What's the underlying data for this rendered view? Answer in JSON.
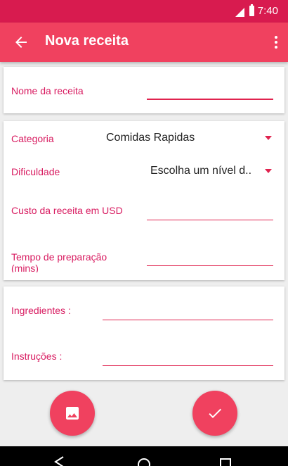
{
  "status": {
    "time": "7:40"
  },
  "appbar": {
    "title": "Nova receita"
  },
  "form": {
    "recipe_name_label": "Nome da receita",
    "category_label": "Categoria",
    "category_value": "Comidas Rapidas",
    "difficulty_label": "Dificuldade",
    "difficulty_value": "Escolha um nível d..",
    "cost_label": "Custo da receita em USD",
    "prep_time_label": "Tempo de preparação (mins)",
    "ingredients_label": "Ingredientes :",
    "instructions_label": "Instruções :"
  },
  "colors": {
    "accent": "#f0415f",
    "status": "#d81b4f",
    "label": "#d81b60"
  },
  "icons": {
    "back": "arrow-back-icon",
    "more": "more-vert-icon",
    "image": "image-icon",
    "done": "check-icon"
  }
}
